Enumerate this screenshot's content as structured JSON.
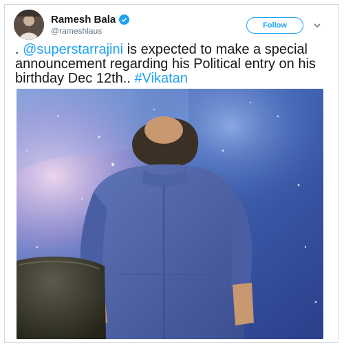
{
  "tweet": {
    "display_name": "Ramesh Bala",
    "handle": "@rameshlaus",
    "follow_label": "Follow",
    "text_prefix": ". ",
    "mention": "@superstarrajini",
    "text_body": " is expected to make a special announcement regarding his Political entry on his birthday Dec 12th.. ",
    "hashtag": "#Vikatan"
  },
  "colors": {
    "accent": "#1da1f2",
    "text": "#14171a",
    "muted": "#657786"
  },
  "icons": {
    "verified": "verified-badge-icon",
    "menu": "chevron-down-icon"
  }
}
